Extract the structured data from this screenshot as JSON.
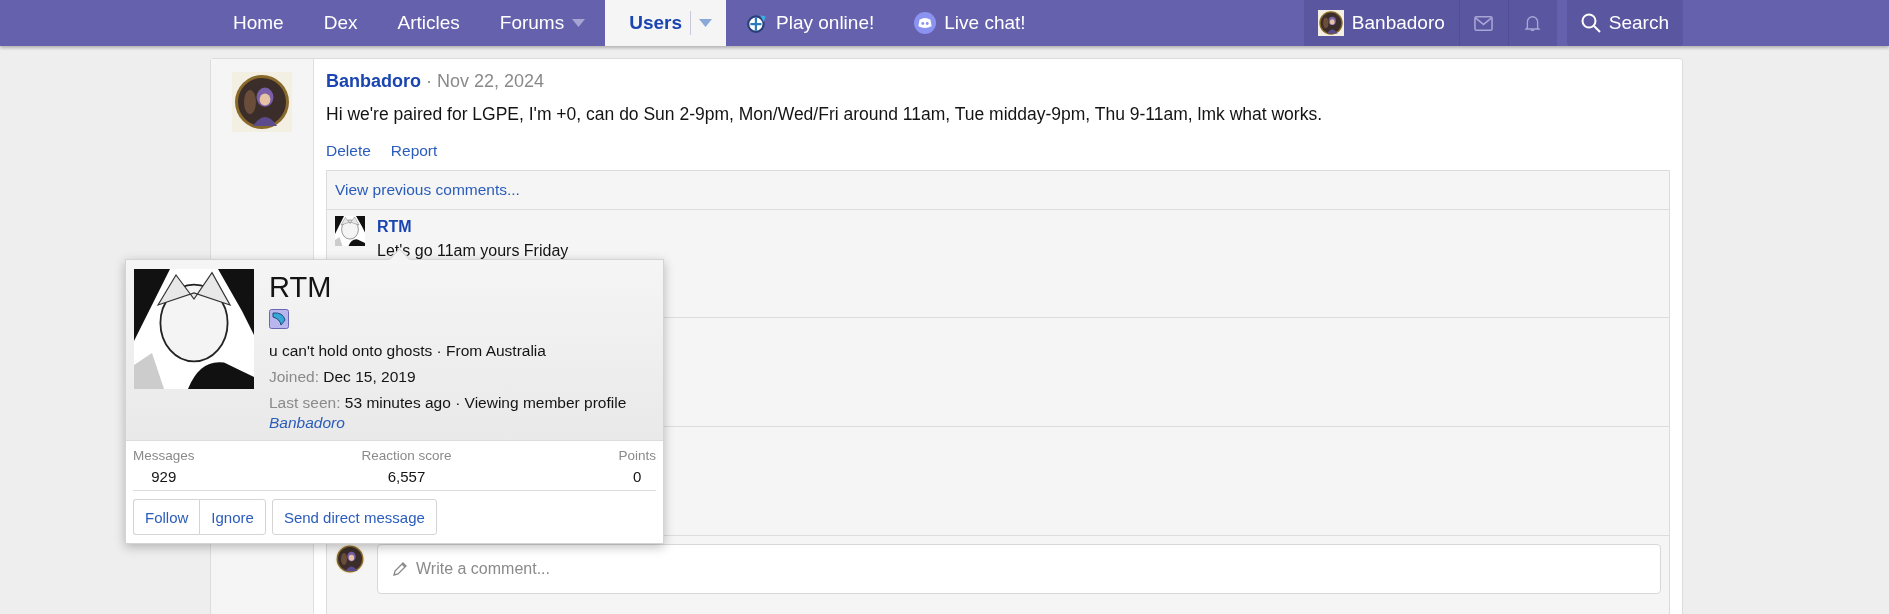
{
  "nav": {
    "items": [
      {
        "label": "Home",
        "selected": false,
        "dropdown": false
      },
      {
        "label": "Dex",
        "selected": false,
        "dropdown": false
      },
      {
        "label": "Articles",
        "selected": false,
        "dropdown": false
      },
      {
        "label": "Forums",
        "selected": false,
        "dropdown": true
      },
      {
        "label": "Users",
        "selected": true,
        "dropdown": true
      },
      {
        "label": "Play online!",
        "selected": false,
        "dropdown": false,
        "kind": "game"
      },
      {
        "label": "Live chat!",
        "selected": false,
        "dropdown": false,
        "kind": "chat"
      }
    ],
    "user": "Banbadoro",
    "search": "Search"
  },
  "post": {
    "author": "Banbadoro",
    "separator": "·",
    "date": "Nov 22, 2024",
    "text": "Hi we're paired for LGPE, I'm +0, can do Sun 2-9pm, Mon/Wed/Fri around 11am, Tue midday-9pm, Thu 9-11am, lmk what works.",
    "actions": [
      "Delete",
      "Report"
    ],
    "comments": {
      "view_previous": "View previous comments...",
      "items": [
        {
          "author": "RTM",
          "text": "Let's go 11am yours Friday"
        }
      ],
      "placeholder": "Write a comment..."
    }
  },
  "tooltip": {
    "name": "RTM",
    "about": "u can't hold onto ghosts · From Australia",
    "joined_label": "Joined:",
    "joined": "Dec 15, 2019",
    "last_seen_label": "Last seen:",
    "last_seen": "53 minutes ago · Viewing member profile",
    "activity_link": "Banbadoro",
    "stats": [
      {
        "label": "Messages",
        "value": "929"
      },
      {
        "label": "Reaction score",
        "value": "6,557"
      },
      {
        "label": "Points",
        "value": "0"
      }
    ],
    "buttons": [
      "Follow",
      "Ignore",
      "Send direct message"
    ]
  }
}
